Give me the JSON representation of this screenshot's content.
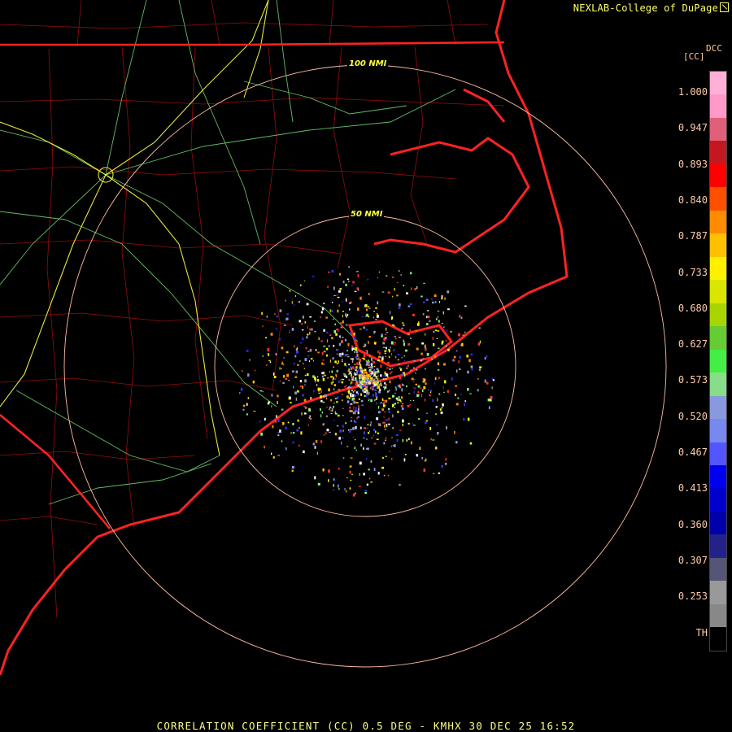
{
  "credit": {
    "text": "NEXLAB-College of DuPage"
  },
  "product_code": "DCC",
  "units": "[CC]",
  "legend_ticks": [
    "1.000",
    "0.947",
    "0.893",
    "0.840",
    "0.787",
    "0.733",
    "0.680",
    "0.627",
    "0.573",
    "0.520",
    "0.467",
    "0.413",
    "0.360",
    "0.307",
    "0.253",
    "TH"
  ],
  "colorbar_colors": [
    "#ffb0d8",
    "#ff99c8",
    "#e0607a",
    "#c41820",
    "#ff0000",
    "#ff5000",
    "#ff8c00",
    "#ffc000",
    "#fff000",
    "#d8e600",
    "#a8d400",
    "#66cc33",
    "#44ee44",
    "#88dd88",
    "#8899dd",
    "#7788ee",
    "#5555ff",
    "#0000ee",
    "#0000cc",
    "#0000aa",
    "#222288",
    "#555577",
    "#999999",
    "#888888",
    "#000000"
  ],
  "range_rings": [
    {
      "label": "50 NMI"
    },
    {
      "label": "100 NMI"
    }
  ],
  "footer": "CORRELATION COEFFICIENT (CC) 0.5 DEG - KMHX 30 DEC 25 16:52",
  "colors": {
    "state_lines": "#ff2222",
    "county_lines": "#cc1111",
    "highways_green": "#77dd77",
    "highways_yellow": "#ffff44",
    "ring": "#ffbba0"
  }
}
